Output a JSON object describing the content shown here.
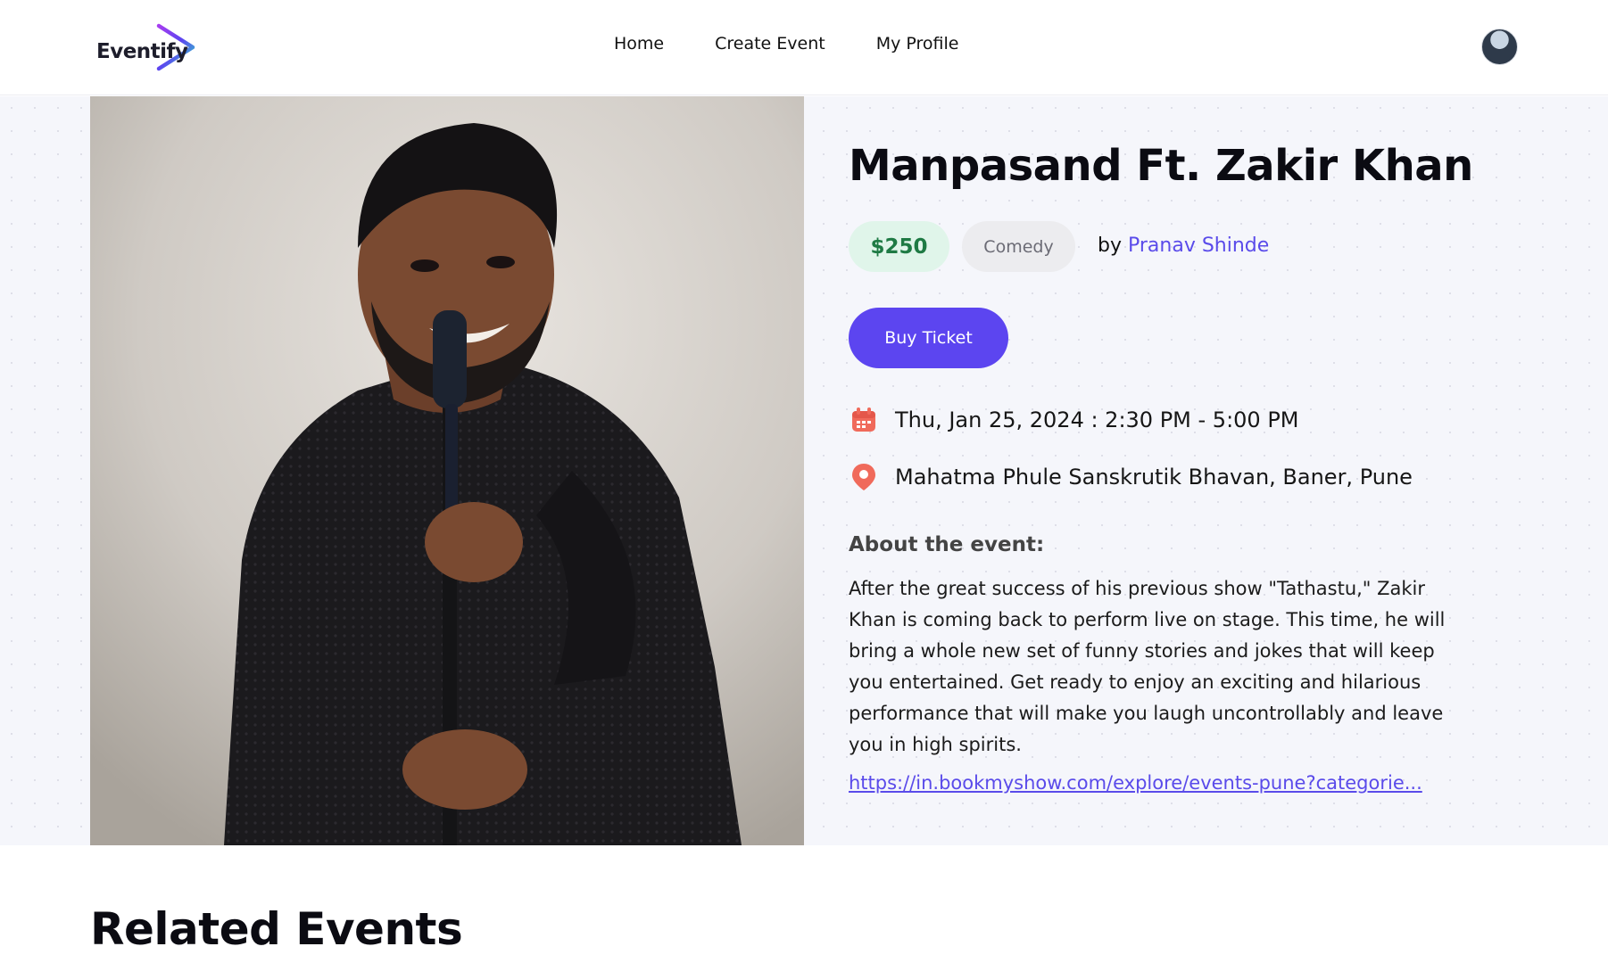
{
  "header": {
    "logo_text": "Eventify",
    "nav": [
      "Home",
      "Create Event",
      "My Profile"
    ]
  },
  "event": {
    "title": "Manpasand Ft. Zakir Khan",
    "price": "$250",
    "category": "Comedy",
    "organizer_prefix": "by",
    "organizer_name": "Pranav Shinde",
    "buy_label": "Buy Ticket",
    "datetime": "Thu, Jan 25, 2024 : 2:30 PM - 5:00 PM",
    "location": "Mahatma Phule Sanskrutik Bhavan, Baner, Pune",
    "about_label": "About the event:",
    "about_text": "After the great success of his previous show \"Tathastu,\" Zakir Khan is coming back to perform live on stage. This time, he will bring a whole new set of funny stories and jokes that will keep you entertained. Get ready to enjoy an exciting and hilarious performance that will make you laugh uncontrollably and leave you in high spirits.",
    "link": "https://in.bookmyshow.com/explore/events-pune?categorie..."
  },
  "related": {
    "title": "Related Events"
  },
  "icons": {
    "calendar": "calendar-icon",
    "location": "location-pin-icon"
  },
  "colors": {
    "accent": "#5c45f0",
    "link": "#5a4bea",
    "price_bg": "#e0f5ea",
    "price_text": "#1e7a44",
    "icon_red": "#f06a5b"
  }
}
